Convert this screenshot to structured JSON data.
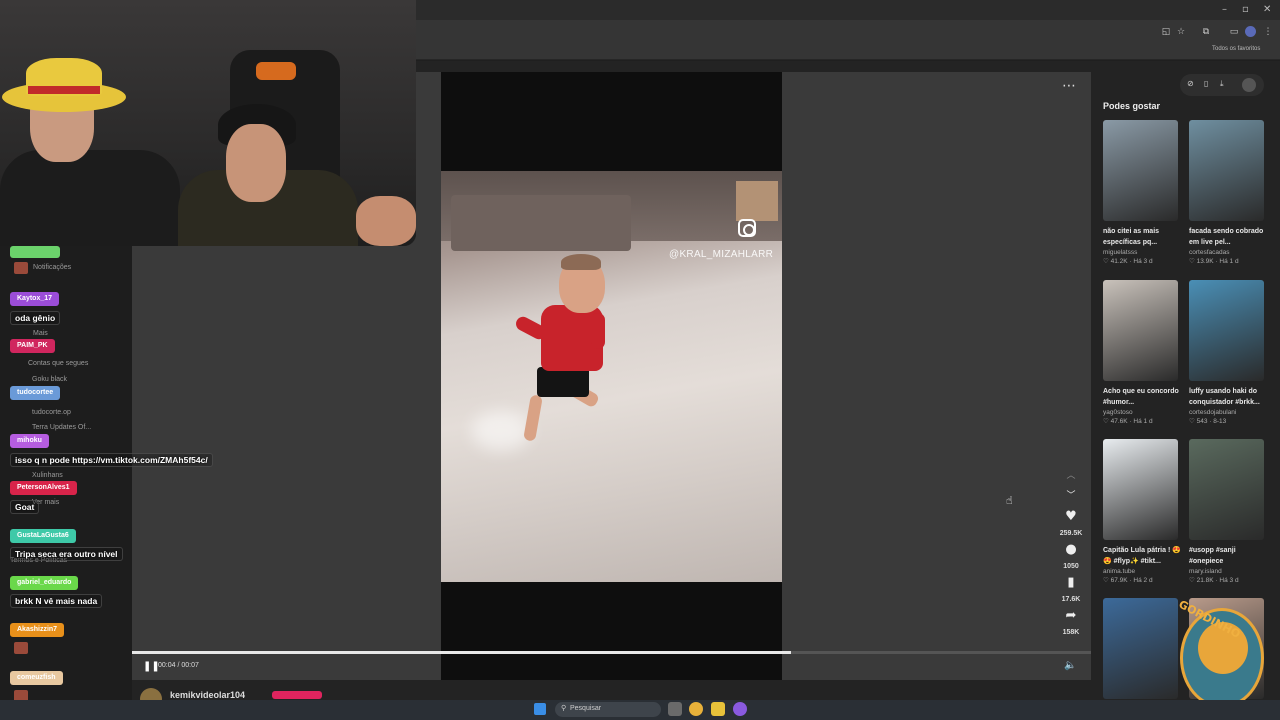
{
  "browser": {
    "bookmarks_label": "Todos os favoritos"
  },
  "video": {
    "watermark": "@KRAL_MIZAHLARR",
    "time": "00:04 / 00:07",
    "progress_fraction": 0.687,
    "author": "kemikvideolar104",
    "stats": {
      "likes": "259.5K",
      "comments": "1050",
      "saves": "17.6K",
      "shares": "158K"
    }
  },
  "suggestions": {
    "title": "Podes gostar",
    "cards": [
      {
        "title": "não citei as mais específicas pq...",
        "author": "miguelatsss",
        "likes": "41.2K",
        "age": "Há 3 d",
        "thumb_color": "#8a9aa6"
      },
      {
        "title": "facada sendo cobrado em live pel...",
        "author": "cortesfacadas",
        "likes": "13.9K",
        "age": "Há 1 d",
        "thumb_color": "#6f8fa0"
      },
      {
        "title": "Acho que eu concordo #humor...",
        "author": "yag0stoso",
        "likes": "47.6K",
        "age": "Há 1 d",
        "thumb_color": "#c9c2bb"
      },
      {
        "title": "luffy usando haki do conquistador #brkk...",
        "author": "cortesdojabulani",
        "likes": "543",
        "age": "8-13",
        "thumb_color": "#4a8fb6"
      },
      {
        "title": "Capitão Lula pátria ! 😍😍 #flyp✨ #tikt...",
        "author": "anima.tube",
        "likes": "67.9K",
        "age": "Há 2 d",
        "thumb_color": "#e8ecef"
      },
      {
        "title": "#usopp #sanji #onepiece",
        "author": "mary.island",
        "likes": "21.8K",
        "age": "Há 3 d",
        "thumb_color": "#5a6a5e"
      },
      {
        "title": "",
        "author": "",
        "likes": "",
        "age": "",
        "thumb_color": "#3c6a9a"
      },
      {
        "title": "",
        "author": "",
        "likes": "",
        "age": "",
        "thumb_color": "#b89a8a"
      }
    ]
  },
  "chat": [
    {
      "user": "Kaytox_17",
      "color": "#9b4dd8",
      "text": "oda gênio"
    },
    {
      "user": "PAIM_PK",
      "color": "#d0265e",
      "text": ""
    },
    {
      "user": "tudocortee",
      "color": "#6a9ad8",
      "text": ""
    },
    {
      "user": "mihoku",
      "color": "#b65de0",
      "text": "isso q n pode https://vm.tiktok.com/ZMAh5f54c/"
    },
    {
      "user": "PetersonAlves1",
      "color": "#d8244a",
      "text": "Goat"
    },
    {
      "user": "GustaLaGusta6",
      "color": "#3ec9a8",
      "text": "Tripa seca era outro nível"
    },
    {
      "user": "gabriel_eduardo",
      "color": "#6ad84a",
      "text": "brkk N vê mais nada"
    },
    {
      "user": "Akashizzin7",
      "color": "#e8901a",
      "text": ""
    },
    {
      "user": "comeuzfish",
      "color": "#e8c8a0",
      "text": ""
    }
  ],
  "sidebar_ghost": {
    "notifications": "Notificações",
    "more": "Mais",
    "following": "Contas que segues",
    "item1": "Goku black",
    "item2": "tudocorte.op",
    "item3": "Terra Updates Of...",
    "item4": "Xulinhans",
    "see_more": "Ver mais",
    "terms": "Termos e Políticas"
  },
  "taskbar": {
    "search_label": "Pesquisar"
  },
  "mascot": {
    "text": "GORDINHO"
  }
}
